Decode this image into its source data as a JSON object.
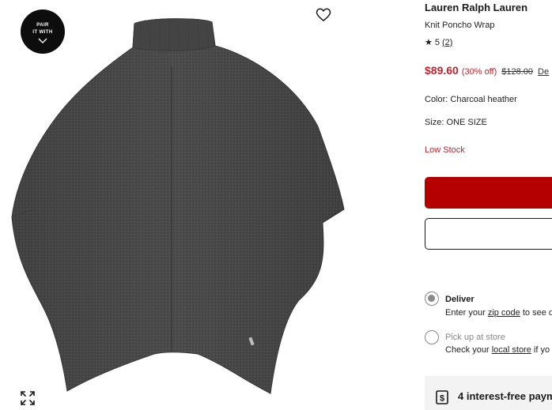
{
  "gallery": {
    "pair_badge_text": "PAIR\nIT WITH",
    "icons": {
      "pair": "chevron-down-icon",
      "favorite": "heart-icon",
      "expand": "expand-icon"
    }
  },
  "product": {
    "brand": "Lauren Ralph Lauren",
    "name": "Knit Poncho Wrap",
    "rating": {
      "star": "★",
      "value": "5",
      "count": "(2)"
    },
    "price": {
      "sale": "$89.60",
      "discount": "(30% off)",
      "original": "$128.00",
      "more_link": "De"
    },
    "color": {
      "label": "Color: ",
      "value": "Charcoal heather"
    },
    "size": {
      "label": "Size: ",
      "value": "ONE SIZE"
    },
    "stock": "Low Stock"
  },
  "fulfillment": {
    "deliver": {
      "title": "Deliver",
      "sub_prefix": "Enter your ",
      "sub_link": "zip code",
      "sub_suffix": " to see d"
    },
    "pickup": {
      "title": "Pick up at store",
      "sub_prefix": "Check your ",
      "sub_link": "local store",
      "sub_suffix": " if yo"
    }
  },
  "payment_banner": {
    "text": "4 interest-free paym",
    "icon": "dollar-card-icon"
  },
  "colors": {
    "sale_red": "#c4222c",
    "button_red": "#b50000",
    "badge_black": "#0d0d0d",
    "poncho_gray": "#4a4a4a"
  }
}
